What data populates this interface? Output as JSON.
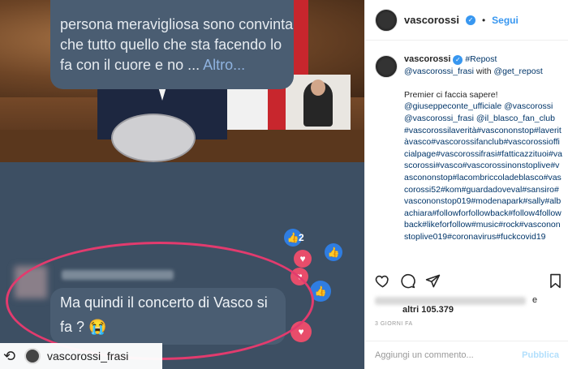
{
  "post_image": {
    "comment_text": "persona meravigliosa sono convinta che tutto quello che sta facendo lo fa con il cuore e no ...",
    "comment_more": "Altro...",
    "reaction_count": "2",
    "reply_text": "Ma quindi il concerto di Vasco si fa ? 😭",
    "repost_user": "vascorossi_frasi"
  },
  "header": {
    "username": "vascorossi",
    "dot": "•",
    "follow_label": "Segui"
  },
  "caption": {
    "username": "vascorossi",
    "repost_tag": "#Repost",
    "line1_user": "@vascorossi_frasi",
    "line1_with": " with ",
    "line1_app": "@get_repost",
    "intro": "Premier ci faccia sapere!",
    "mentions": "@giuseppeconte_ufficiale @vascorossi @vascorossi_frasi @il_blasco_fan_club",
    "hashtags": "#vascorossilaverità#vascononstop#laveritàvasco#vascorossifanclub#vascorossiofficialpage#vascorossifrasi#fatticazzituoi#vascorossi#vasco#vascorossinonstoplive#vascononstop#lacombriccoladeblasco#vascorossi52#kom#guardadoveval#sansiro#vascononstop019#modenapark#sally#albachiara#followforfollowback#follow4followback#likeforfollow#music#rock#vascononstoplive019#coronavirus#fuckcovid19"
  },
  "likes": {
    "tail": "e",
    "others": "altri 105.379"
  },
  "time": "3 GIORNI FA",
  "comment_box": {
    "placeholder": "Aggiungi un commento...",
    "publish_label": "Pubblica"
  }
}
